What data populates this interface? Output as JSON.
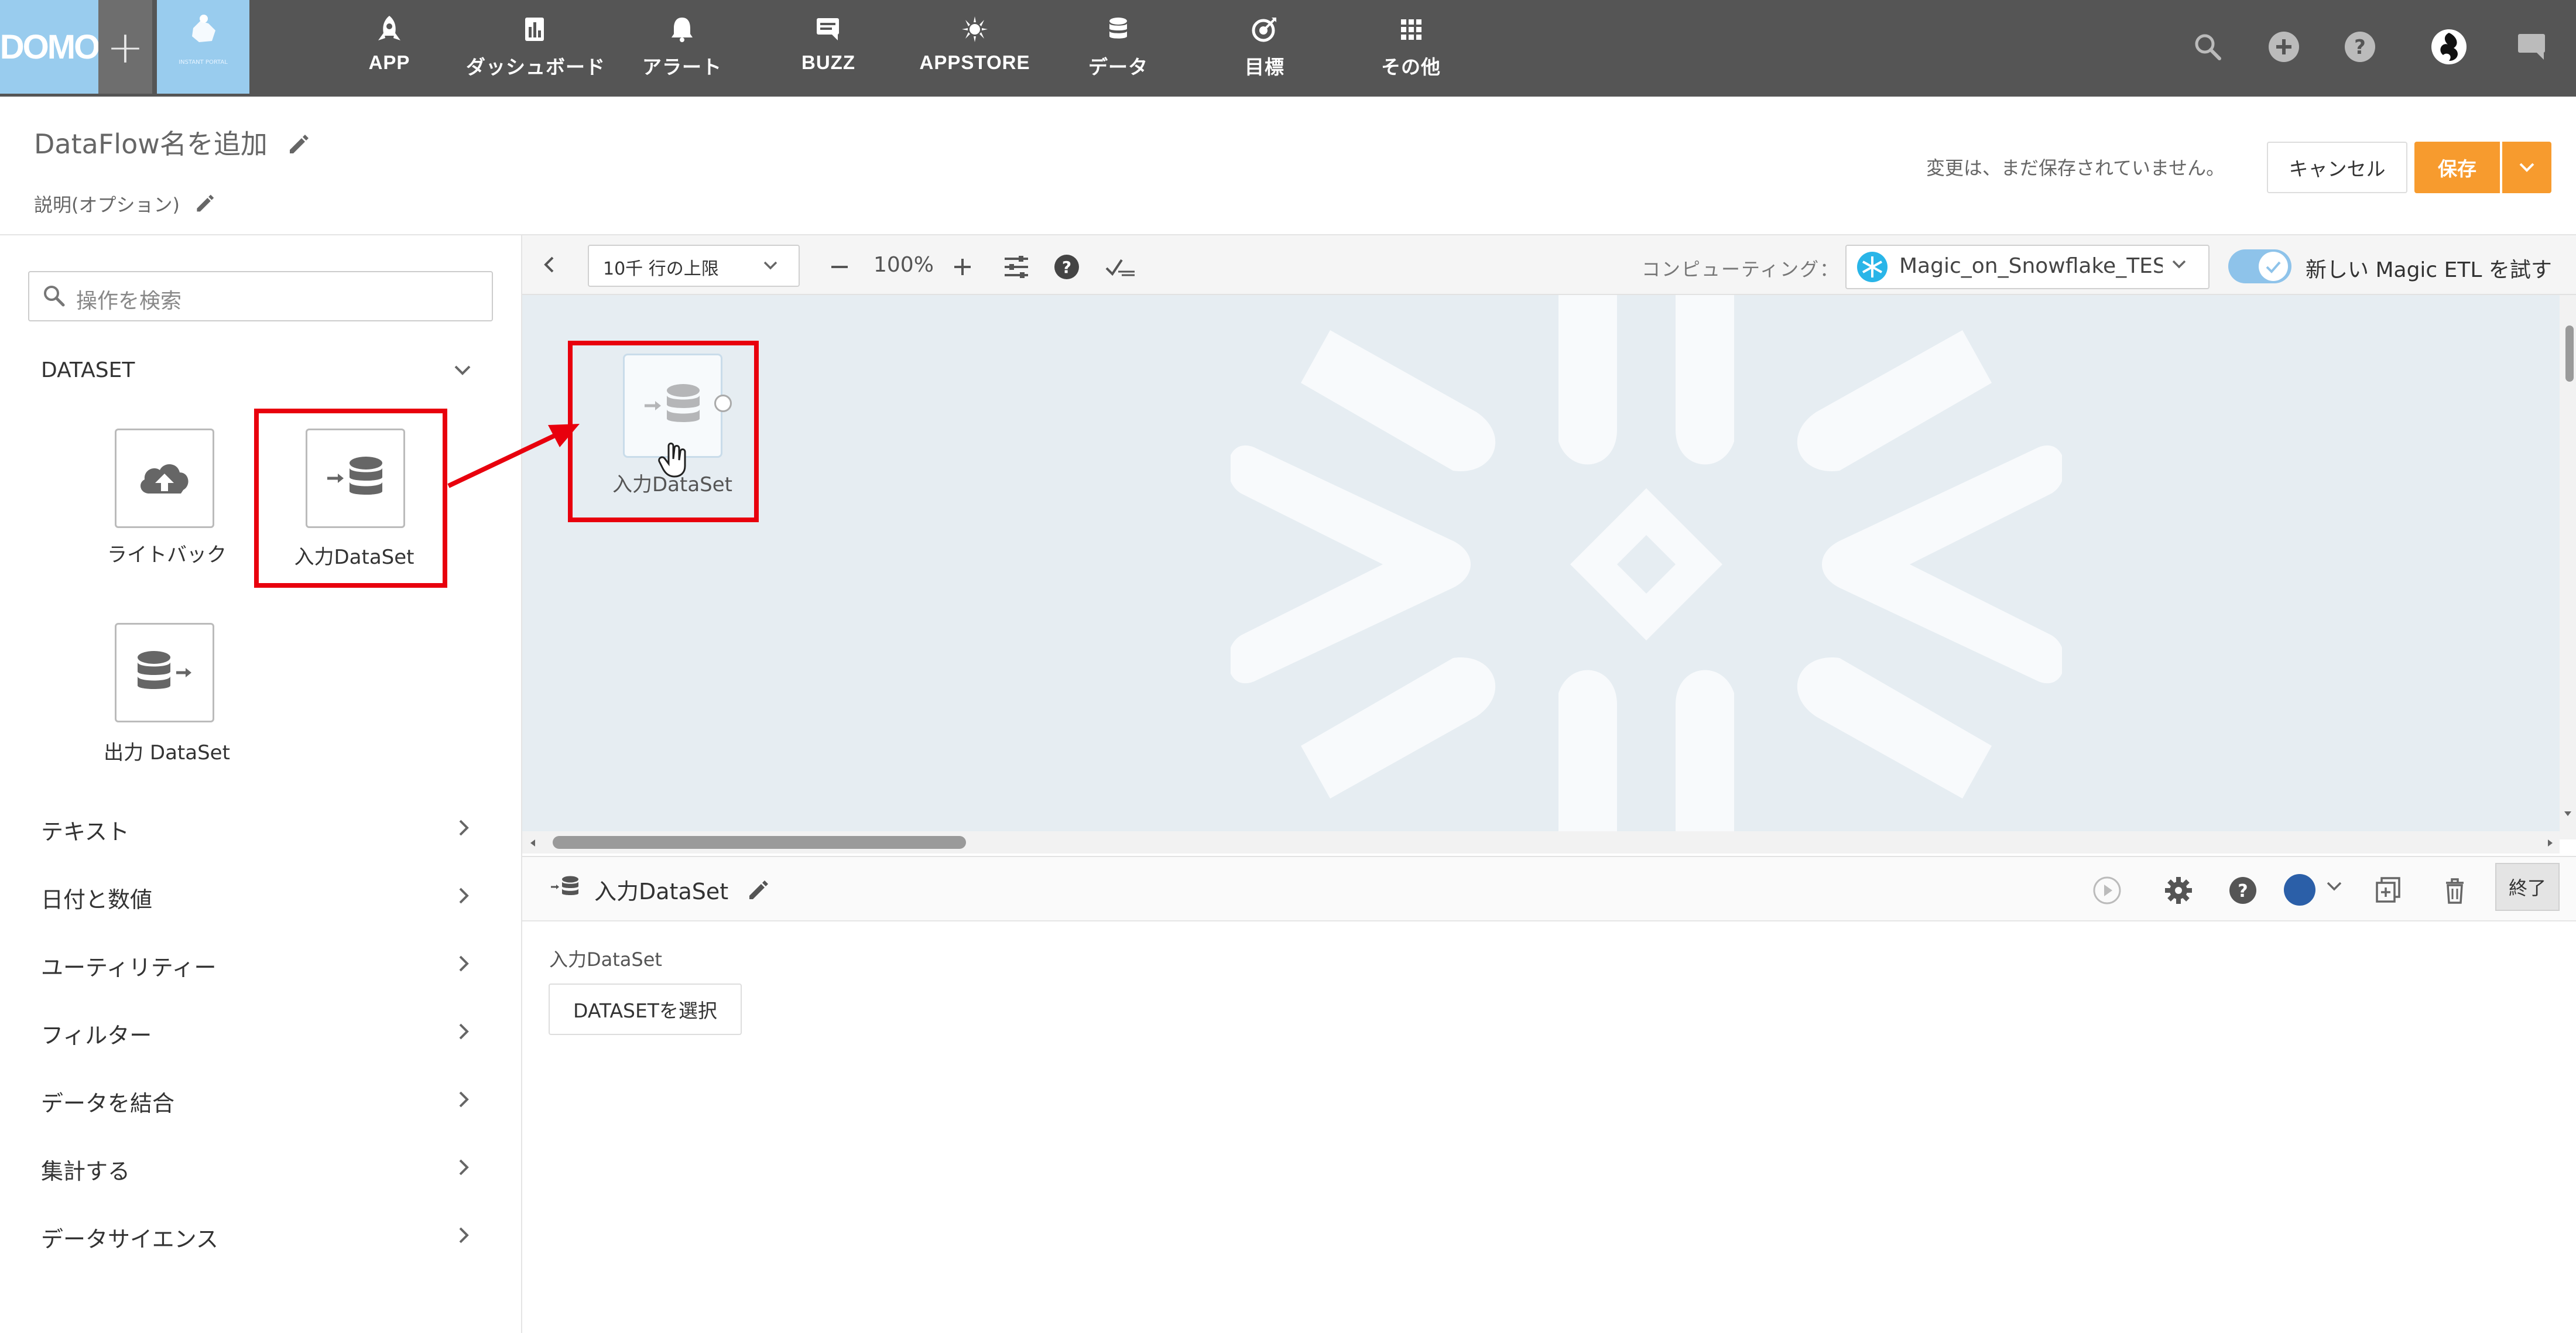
{
  "nav": {
    "logo": "DOMO",
    "portal_label": "INSTANT PORTAL",
    "items": [
      {
        "label": "APP",
        "icon": "rocket-icon"
      },
      {
        "label": "ダッシュボード",
        "icon": "dashboard-icon"
      },
      {
        "label": "アラート",
        "icon": "bell-icon"
      },
      {
        "label": "BUZZ",
        "icon": "chat-icon"
      },
      {
        "label": "APPSTORE",
        "icon": "appstore-icon"
      },
      {
        "label": "データ",
        "icon": "database-icon"
      },
      {
        "label": "目標",
        "icon": "target-icon"
      },
      {
        "label": "その他",
        "icon": "grid-icon"
      }
    ]
  },
  "header": {
    "title": "DataFlow名を追加",
    "description": "説明(オプション)",
    "unsaved_msg": "変更は、まだ保存されていません。",
    "cancel_label": "キャンセル",
    "save_label": "保存"
  },
  "sidebar": {
    "search_placeholder": "操作を検索",
    "section_title": "DATASET",
    "tiles": [
      {
        "label": "ライトバック"
      },
      {
        "label": "入力DataSet"
      },
      {
        "label": "出力 DataSet"
      }
    ],
    "categories": [
      "テキスト",
      "日付と数値",
      "ユーティリティー",
      "フィルター",
      "データを結合",
      "集計する",
      "データサイエンス"
    ]
  },
  "toolbar": {
    "row_limit": "10千 行の上限",
    "zoom": "100%",
    "compute_label": "コンピューティング：",
    "compute_value": "Magic_on_Snowflake_TES",
    "new_etl_label": "新しい Magic ETL を試す"
  },
  "canvas": {
    "node_label": "入力DataSet"
  },
  "details": {
    "title": "入力DataSet",
    "field_label": "入力DataSet",
    "select_button": "DATASETを選択",
    "done_label": "終了"
  },
  "colors": {
    "nav_bg": "#555555",
    "accent_blue": "#99ccee",
    "save_orange": "#f79b2e",
    "highlight_red": "#e8000d",
    "canvas_bg": "#e6edf2"
  }
}
